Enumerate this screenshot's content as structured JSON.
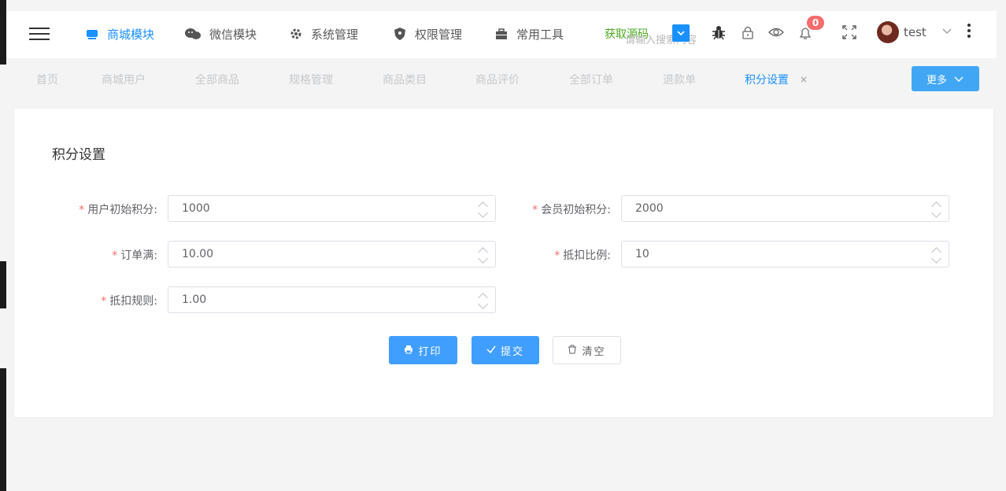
{
  "topnav": {
    "items": [
      {
        "label": "商城模块",
        "active": true,
        "icon": "shop-icon"
      },
      {
        "label": "微信模块",
        "active": false,
        "icon": "wechat-icon"
      },
      {
        "label": "系统管理",
        "active": false,
        "icon": "settings-icon"
      },
      {
        "label": "权限管理",
        "active": false,
        "icon": "shield-icon"
      },
      {
        "label": "常用工具",
        "active": false,
        "icon": "briefcase-icon"
      }
    ],
    "get_source": "获取源码",
    "search_placeholder": "请输入搜索内容",
    "notification_count": "0",
    "username": "test"
  },
  "tabs": {
    "items": [
      "首页",
      "商城用户",
      "全部商品",
      "规格管理",
      "商品类目",
      "商品评价",
      "全部订单",
      "退款单",
      "积分设置"
    ],
    "active": "积分设置",
    "close": "×",
    "more": "更多"
  },
  "form": {
    "title": "积分设置",
    "user_initial_points": {
      "label": "用户初始积分:",
      "value": "1000"
    },
    "member_initial_points": {
      "label": "会员初始积分:",
      "value": "2000"
    },
    "order_full": {
      "label": "订单满:",
      "value": "10.00"
    },
    "deduct_ratio": {
      "label": "抵扣比例:",
      "value": "10"
    },
    "deduct_rule": {
      "label": "抵扣规则:",
      "value": "1.00"
    },
    "buttons": {
      "print": "打印",
      "submit": "提交",
      "clear": "清空"
    }
  },
  "colors": {
    "primary": "#409eff",
    "active_nav": "#1890ff",
    "required": "#f56c6c",
    "source_link": "#49a81c"
  }
}
